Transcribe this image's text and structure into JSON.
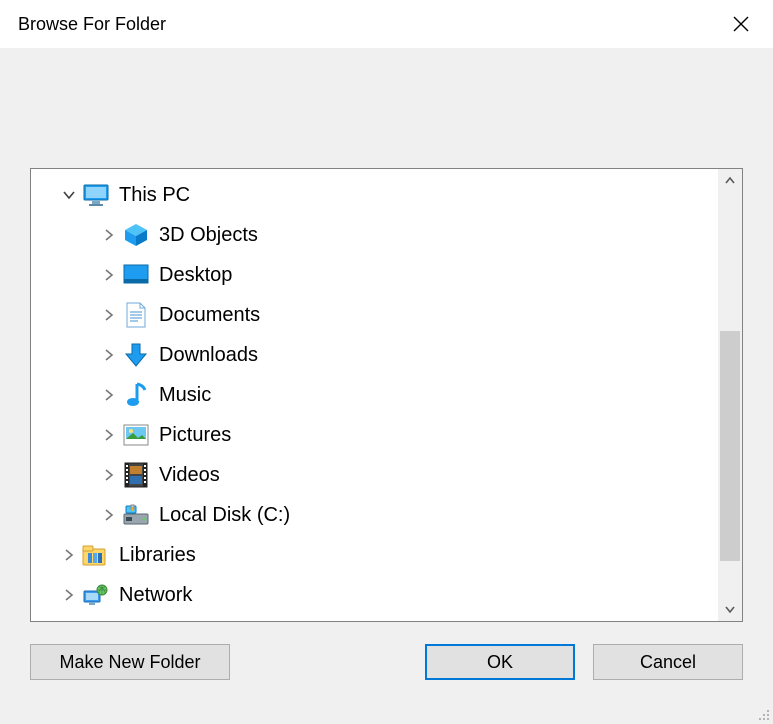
{
  "title": "Browse For Folder",
  "tree": {
    "root": {
      "label": "This PC",
      "expanded": true,
      "children": [
        {
          "label": "3D Objects",
          "icon": "cube"
        },
        {
          "label": "Desktop",
          "icon": "desktop"
        },
        {
          "label": "Documents",
          "icon": "document"
        },
        {
          "label": "Downloads",
          "icon": "download"
        },
        {
          "label": "Music",
          "icon": "music"
        },
        {
          "label": "Pictures",
          "icon": "pictures"
        },
        {
          "label": "Videos",
          "icon": "videos"
        },
        {
          "label": "Local Disk (C:)",
          "icon": "disk"
        }
      ]
    },
    "siblings": [
      {
        "label": "Libraries",
        "icon": "libraries"
      },
      {
        "label": "Network",
        "icon": "network"
      }
    ]
  },
  "buttons": {
    "make_new_folder": "Make New Folder",
    "ok": "OK",
    "cancel": "Cancel"
  }
}
